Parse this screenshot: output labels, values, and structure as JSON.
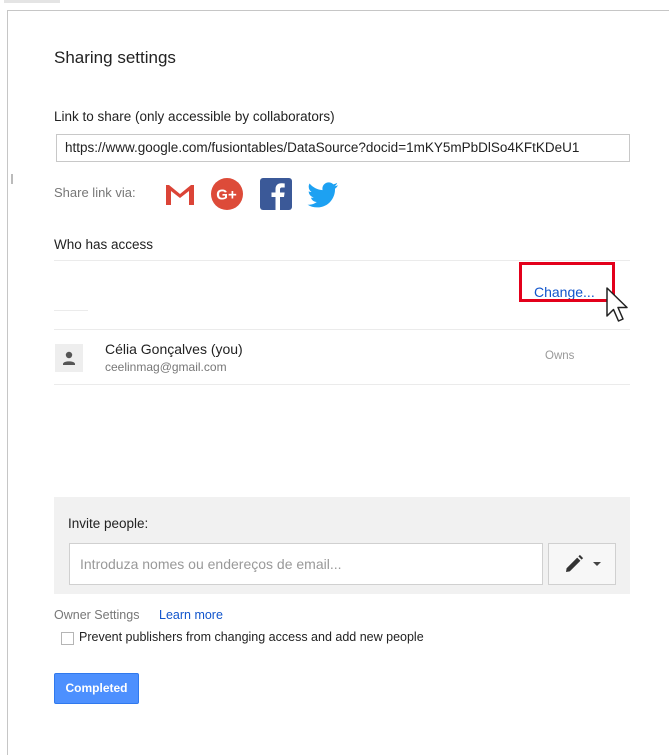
{
  "dialog": {
    "title": "Sharing settings",
    "link_section": {
      "label": "Link to share (only accessible by collaborators)",
      "url": "https://www.google.com/fusiontables/DataSource?docid=1mKY5mPbDlSo4KFtKDeU1"
    },
    "share_via": {
      "label": "Share link via:",
      "icons": [
        "gmail-icon",
        "google-plus-icon",
        "facebook-icon",
        "twitter-icon"
      ]
    },
    "access": {
      "label": "Who has access",
      "change_link": "Change...",
      "users": [
        {
          "name": "Célia Gonçalves (you)",
          "email": "ceelinmag@gmail.com",
          "role": "Owns"
        }
      ]
    },
    "invite": {
      "label": "Invite people:",
      "placeholder": "Introduza nomes ou endereços de email..."
    },
    "owner_settings": {
      "label": "Owner Settings",
      "learn_more": "Learn more",
      "prevent_option": "Prevent publishers from changing access and add new people",
      "prevent_checked": false
    },
    "completed_button": "Completed"
  },
  "colors": {
    "link": "#1155cc",
    "primary_button": "#4d90fe",
    "highlight": "#e3001b",
    "gmail": "#db4437",
    "google_plus": "#dd4b39",
    "facebook": "#3b5998",
    "twitter": "#1da1f2"
  }
}
